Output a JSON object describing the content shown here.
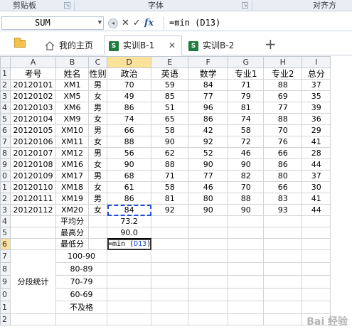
{
  "ribbon": {
    "groups": [
      "剪贴板",
      "字体",
      "对齐方"
    ]
  },
  "formula_bar": {
    "name_box": "SUM",
    "cancel_symbol": "✕",
    "confirm_symbol": "✓",
    "fx_label": "fx",
    "content": "=min (D13)"
  },
  "tabs": [
    {
      "label": "我的主页",
      "icon": "home-icon",
      "active": false
    },
    {
      "label": "实训B-1",
      "icon": "spreadsheet-icon",
      "active": true,
      "close": "✕"
    },
    {
      "label": "实训B-2",
      "icon": "spreadsheet-icon",
      "active": false
    }
  ],
  "add_tab_symbol": "+",
  "columns": [
    "A",
    "B",
    "C",
    "D",
    "E",
    "F",
    "G",
    "H",
    "I"
  ],
  "active_column": "D",
  "rows": [
    {
      "n": "1",
      "cells": [
        "考号",
        "姓名",
        "性别",
        "政治",
        "英语",
        "数学",
        "专业1",
        "专业2",
        "总分"
      ]
    },
    {
      "n": "2",
      "cells": [
        "20120101",
        "XM1",
        "男",
        "70",
        "59",
        "84",
        "71",
        "88",
        "37"
      ]
    },
    {
      "n": "3",
      "cells": [
        "20120102",
        "XM5",
        "女",
        "49",
        "85",
        "77",
        "79",
        "69",
        "35"
      ]
    },
    {
      "n": "4",
      "cells": [
        "20120103",
        "XM6",
        "男",
        "86",
        "51",
        "96",
        "81",
        "77",
        "39"
      ]
    },
    {
      "n": "5",
      "cells": [
        "20120104",
        "XM9",
        "女",
        "74",
        "65",
        "86",
        "74",
        "88",
        "36"
      ]
    },
    {
      "n": "6",
      "cells": [
        "20120105",
        "XM10",
        "男",
        "66",
        "58",
        "42",
        "58",
        "70",
        "29"
      ]
    },
    {
      "n": "7",
      "cells": [
        "20120106",
        "XM11",
        "女",
        "88",
        "90",
        "92",
        "72",
        "76",
        "41"
      ]
    },
    {
      "n": "8",
      "cells": [
        "20120107",
        "XM12",
        "男",
        "56",
        "62",
        "52",
        "46",
        "66",
        "28"
      ]
    },
    {
      "n": "9",
      "cells": [
        "20120108",
        "XM16",
        "女",
        "90",
        "88",
        "90",
        "90",
        "86",
        "44"
      ]
    },
    {
      "n": "0",
      "cells": [
        "20120109",
        "XM17",
        "男",
        "68",
        "71",
        "77",
        "82",
        "80",
        "37"
      ]
    },
    {
      "n": "1",
      "cells": [
        "20120110",
        "XM18",
        "女",
        "61",
        "58",
        "46",
        "70",
        "66",
        "30"
      ]
    },
    {
      "n": "2",
      "cells": [
        "20120111",
        "XM19",
        "男",
        "86",
        "81",
        "80",
        "88",
        "83",
        "41"
      ]
    },
    {
      "n": "3",
      "cells": [
        "20120112",
        "XM20",
        "女",
        "84",
        "92",
        "90",
        "90",
        "93",
        "44"
      ]
    }
  ],
  "summary": {
    "avg_label": "平均分",
    "avg_value": "73.2",
    "max_label": "最高分",
    "max_value": "90.0",
    "min_label": "最低分",
    "min_formula_prefix": "=min (",
    "min_formula_ref": "D13",
    "min_formula_suffix": ")",
    "row_numbers": [
      "4",
      "5",
      "6"
    ]
  },
  "segments": {
    "label": "分段统计",
    "ranges": [
      "100-90",
      "80-89",
      "70-79",
      "60-69",
      "不及格"
    ],
    "row_numbers": [
      "7",
      "8",
      "9",
      "0",
      "1",
      "2"
    ]
  },
  "watermark": "Bai 经验"
}
